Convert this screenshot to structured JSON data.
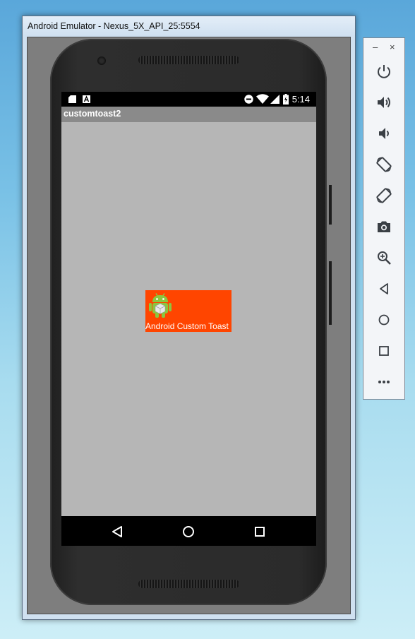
{
  "window": {
    "title": "Android Emulator - Nexus_5X_API_25:5554"
  },
  "status_bar": {
    "left_icons": [
      "sd-card-icon",
      "a-notification-icon"
    ],
    "right_icons": [
      "do-not-disturb-icon",
      "wifi-icon",
      "signal-icon",
      "battery-icon"
    ],
    "time": "5:14"
  },
  "app": {
    "title": "customtoast2"
  },
  "toast": {
    "icon": "android-robot-icon",
    "text": "Android Custom Toast",
    "background": "#ff4500"
  },
  "nav_bar": {
    "buttons": [
      "back-icon",
      "home-icon",
      "recents-icon"
    ]
  },
  "toolbar": {
    "minimize_label": "–",
    "close_label": "×",
    "buttons": [
      "power-icon",
      "volume-up-icon",
      "volume-down-icon",
      "rotate-left-icon",
      "rotate-right-icon",
      "screenshot-icon",
      "zoom-icon",
      "back-icon",
      "home-icon",
      "overview-icon",
      "more-icon"
    ]
  },
  "colors": {
    "screen_bg": "#b6b6b6",
    "action_bar": "#8a8a8a",
    "toolbar_icon": "#3a3f45"
  }
}
